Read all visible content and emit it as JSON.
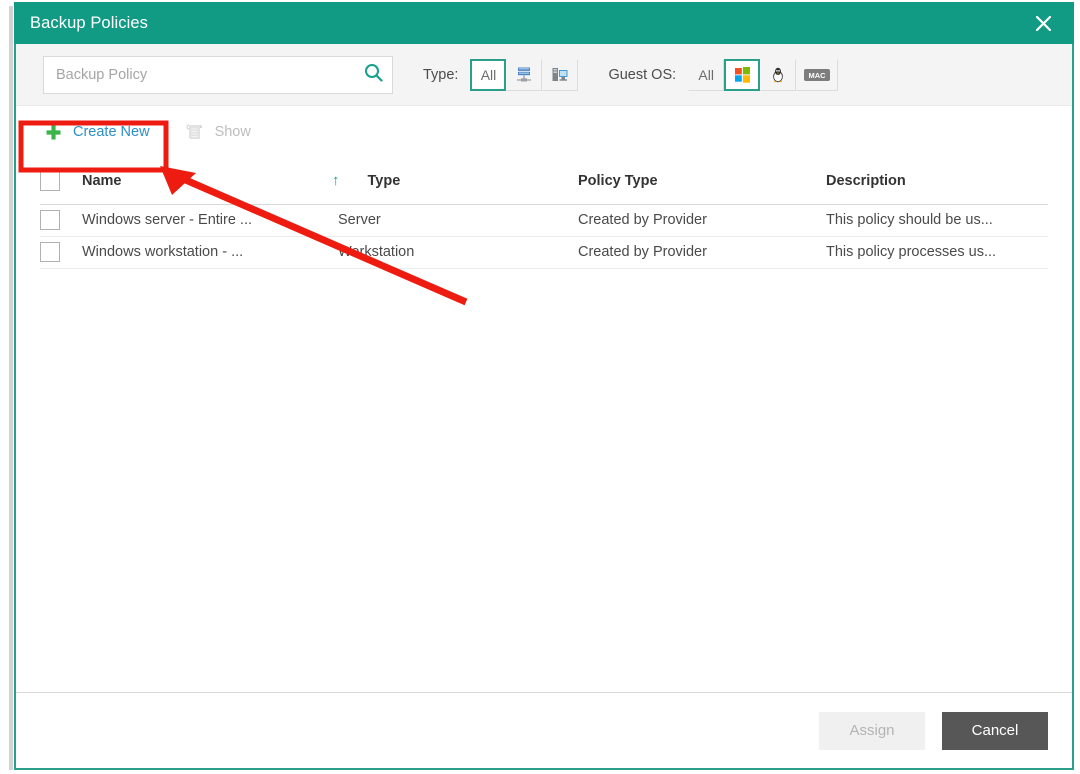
{
  "window": {
    "title": "Backup Policies",
    "close_label": "×",
    "close_icon": "close-icon",
    "accent_color": "#119b84",
    "border_color": "#2aa08c"
  },
  "filters": {
    "search": {
      "placeholder": "Backup Policy",
      "value": "",
      "icon": "search-icon"
    },
    "type": {
      "label": "Type:",
      "options": [
        {
          "label": "All",
          "icon": "text",
          "selected": true
        },
        {
          "label": "",
          "icon": "server-icon",
          "selected": false
        },
        {
          "label": "",
          "icon": "workstation-icon",
          "selected": false
        }
      ]
    },
    "guest_os": {
      "label": "Guest OS:",
      "options": [
        {
          "label": "All",
          "icon": "text",
          "selected": false
        },
        {
          "label": "",
          "icon": "windows-icon",
          "selected": true
        },
        {
          "label": "",
          "icon": "linux-icon",
          "selected": false
        },
        {
          "label": "MAC",
          "icon": "mac-icon",
          "selected": false
        }
      ]
    }
  },
  "toolbar": {
    "create_new_label": "Create New",
    "create_new_icon": "plus-icon",
    "show_label": "Show",
    "show_icon": "scroll-icon",
    "link_color": "#2d8fc8",
    "plus_color": "#3bb54a"
  },
  "table": {
    "columns": [
      {
        "key": "checkbox",
        "label": ""
      },
      {
        "key": "name",
        "label": "Name"
      },
      {
        "key": "type",
        "label": "Type",
        "sort": "asc",
        "sort_icon": "arrow-up-icon"
      },
      {
        "key": "policy_type",
        "label": "Policy Type"
      },
      {
        "key": "description",
        "label": "Description"
      }
    ],
    "rows": [
      {
        "name": "Windows server - Entire ...",
        "type": "Server",
        "policy_type": "Created by Provider",
        "description": "This policy should be us...",
        "checked": false
      },
      {
        "name": "Windows workstation - ...",
        "type": "Workstation",
        "policy_type": "Created by Provider",
        "description": "This policy processes us...",
        "checked": false
      }
    ]
  },
  "footer": {
    "assign_label": "Assign",
    "assign_enabled": false,
    "cancel_label": "Cancel"
  },
  "annotation": {
    "color": "#ee1b11",
    "highlight_target": "Create New",
    "shape": "rectangle-with-arrow"
  }
}
